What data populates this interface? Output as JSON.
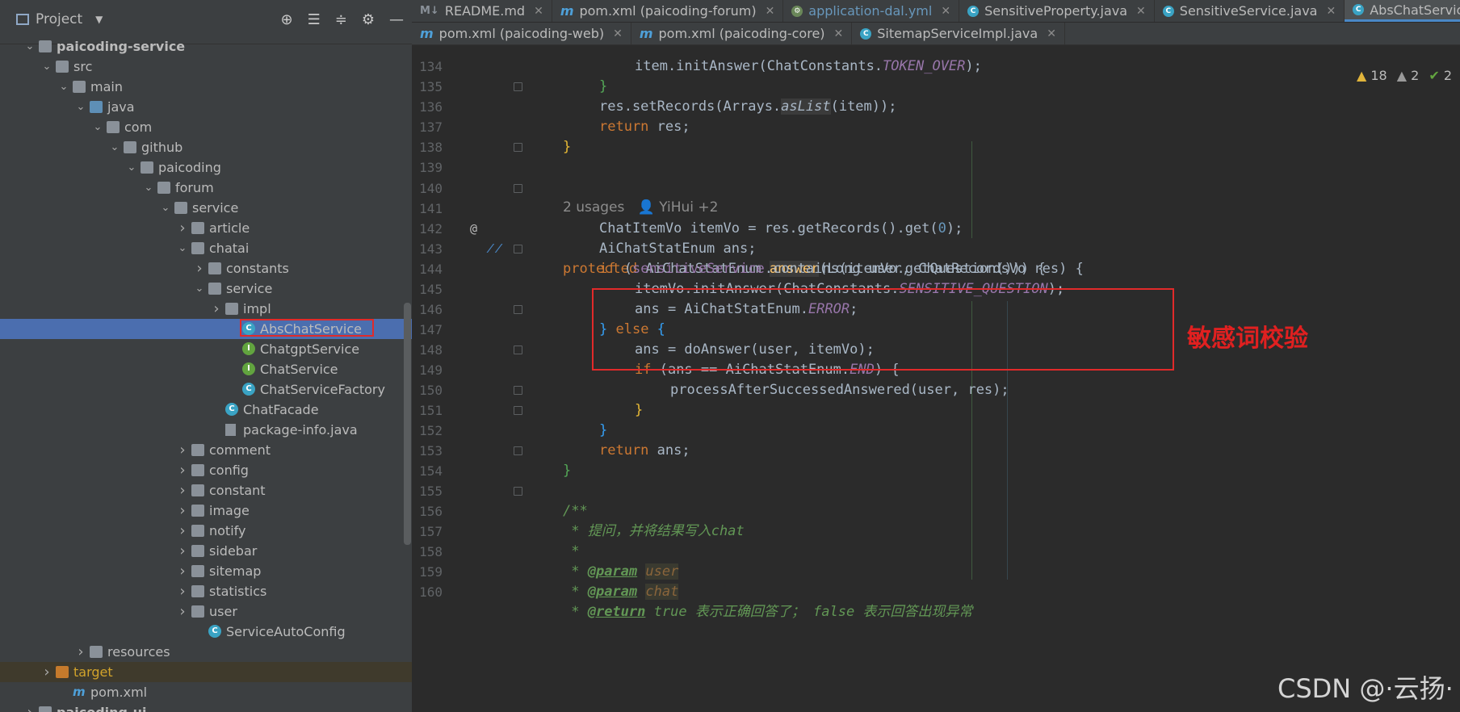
{
  "project_panel": {
    "title": "Project",
    "tree": [
      {
        "label": "paicoding-service",
        "depth": 0,
        "arrow": "down",
        "icon": "module-folder",
        "bold": true
      },
      {
        "label": "src",
        "depth": 1,
        "arrow": "down",
        "icon": "folder"
      },
      {
        "label": "main",
        "depth": 2,
        "arrow": "down",
        "icon": "folder"
      },
      {
        "label": "java",
        "depth": 3,
        "arrow": "down",
        "icon": "source-folder"
      },
      {
        "label": "com",
        "depth": 4,
        "arrow": "down",
        "icon": "package"
      },
      {
        "label": "github",
        "depth": 5,
        "arrow": "down",
        "icon": "package"
      },
      {
        "label": "paicoding",
        "depth": 6,
        "arrow": "down",
        "icon": "package"
      },
      {
        "label": "forum",
        "depth": 7,
        "arrow": "down",
        "icon": "package"
      },
      {
        "label": "service",
        "depth": 8,
        "arrow": "down",
        "icon": "package"
      },
      {
        "label": "article",
        "depth": 9,
        "arrow": "right",
        "icon": "package"
      },
      {
        "label": "chatai",
        "depth": 9,
        "arrow": "down",
        "icon": "package"
      },
      {
        "label": "constants",
        "depth": 10,
        "arrow": "right",
        "icon": "package"
      },
      {
        "label": "service",
        "depth": 10,
        "arrow": "down",
        "icon": "package"
      },
      {
        "label": "impl",
        "depth": 11,
        "arrow": "right",
        "icon": "package"
      },
      {
        "label": "AbsChatService",
        "depth": 12,
        "arrow": "",
        "icon": "class",
        "selected": true
      },
      {
        "label": "ChatgptService",
        "depth": 12,
        "arrow": "",
        "icon": "interface"
      },
      {
        "label": "ChatService",
        "depth": 12,
        "arrow": "",
        "icon": "interface"
      },
      {
        "label": "ChatServiceFactory",
        "depth": 12,
        "arrow": "",
        "icon": "class"
      },
      {
        "label": "ChatFacade",
        "depth": 11,
        "arrow": "",
        "icon": "class"
      },
      {
        "label": "package-info.java",
        "depth": 11,
        "arrow": "",
        "icon": "file"
      },
      {
        "label": "comment",
        "depth": 9,
        "arrow": "right",
        "icon": "package"
      },
      {
        "label": "config",
        "depth": 9,
        "arrow": "right",
        "icon": "package"
      },
      {
        "label": "constant",
        "depth": 9,
        "arrow": "right",
        "icon": "package"
      },
      {
        "label": "image",
        "depth": 9,
        "arrow": "right",
        "icon": "package"
      },
      {
        "label": "notify",
        "depth": 9,
        "arrow": "right",
        "icon": "package"
      },
      {
        "label": "sidebar",
        "depth": 9,
        "arrow": "right",
        "icon": "package"
      },
      {
        "label": "sitemap",
        "depth": 9,
        "arrow": "right",
        "icon": "package"
      },
      {
        "label": "statistics",
        "depth": 9,
        "arrow": "right",
        "icon": "package"
      },
      {
        "label": "user",
        "depth": 9,
        "arrow": "right",
        "icon": "package"
      },
      {
        "label": "ServiceAutoConfig",
        "depth": 10,
        "arrow": "",
        "icon": "class"
      },
      {
        "label": "resources",
        "depth": 3,
        "arrow": "right",
        "icon": "resources-folder"
      },
      {
        "label": "target",
        "depth": 1,
        "arrow": "right",
        "icon": "excluded-folder",
        "target": true
      },
      {
        "label": "pom.xml",
        "depth": 2,
        "arrow": "",
        "icon": "maven"
      },
      {
        "label": "paicoding-ui",
        "depth": 0,
        "arrow": "right",
        "icon": "module-folder",
        "bold": true
      }
    ]
  },
  "tabs_row1": [
    {
      "label": "README.md",
      "icon": "md"
    },
    {
      "label": "pom.xml (paicoding-forum)",
      "icon": "m"
    },
    {
      "label": "application-dal.yml",
      "icon": "yml"
    },
    {
      "label": "SensitiveProperty.java",
      "icon": "c"
    },
    {
      "label": "SensitiveService.java",
      "icon": "c"
    },
    {
      "label": "AbsChatService.java",
      "icon": "c",
      "active": true
    }
  ],
  "tabs_row2": [
    {
      "label": "pom.xml (paicoding-web)",
      "icon": "m"
    },
    {
      "label": "pom.xml (paicoding-core)",
      "icon": "m"
    },
    {
      "label": "SitemapServiceImpl.java",
      "icon": "c"
    }
  ],
  "inspections": {
    "warnings": "18",
    "weak_warnings": "2",
    "typos": "2"
  },
  "usage_hint": {
    "usages": "2 usages",
    "author": "YiHui +2"
  },
  "code_lines": [
    {
      "n": "134",
      "fold": false
    },
    {
      "n": "135",
      "fold": true
    },
    {
      "n": "136",
      "fold": false
    },
    {
      "n": "137",
      "fold": false
    },
    {
      "n": "138",
      "fold": true
    },
    {
      "n": "139",
      "fold": false
    },
    {
      "n": "140",
      "fold": true
    },
    {
      "n": "141",
      "fold": false
    },
    {
      "n": "142",
      "fold": false
    },
    {
      "n": "143",
      "fold": true
    },
    {
      "n": "144",
      "fold": false
    },
    {
      "n": "145",
      "fold": false
    },
    {
      "n": "146",
      "fold": true
    },
    {
      "n": "147",
      "fold": false
    },
    {
      "n": "148",
      "fold": true
    },
    {
      "n": "149",
      "fold": false
    },
    {
      "n": "150",
      "fold": true
    },
    {
      "n": "151",
      "fold": true
    },
    {
      "n": "152",
      "fold": false
    },
    {
      "n": "153",
      "fold": true
    },
    {
      "n": "154",
      "fold": false
    },
    {
      "n": "155",
      "fold": true
    },
    {
      "n": "156",
      "fold": false
    },
    {
      "n": "157",
      "fold": false
    },
    {
      "n": "158",
      "fold": false
    },
    {
      "n": "159",
      "fold": false
    },
    {
      "n": "160",
      "fold": false
    }
  ],
  "code": {
    "l134": {
      "a": "item.initAnswer(ChatConstants.",
      "b": "TOKEN_OVER",
      "c": ");"
    },
    "l135": "}",
    "l136": {
      "a": "res.setRecords(Arrays.",
      "b": "asList",
      "c": "(item));"
    },
    "l137": {
      "kw": "return",
      "rest": " res;"
    },
    "l138": "}",
    "l140": {
      "kw": "protected",
      "t1": " AiChatStatEnum ",
      "fn": "answer",
      "rest": "(Long user, ChatRecordsVo res) {"
    },
    "l141": {
      "a": "ChatItemVo itemVo = res.getRecords().get(",
      "num": "0",
      "c": ");"
    },
    "l142": "AiChatStatEnum ans;",
    "l143": {
      "kw": "if",
      "p1": " (",
      "fld": "sensitiveService",
      "rest": ".contains(itemVo.getQuestion())) {"
    },
    "l144": {
      "a": "itemVo.initAnswer(ChatConstants.",
      "b": "SENSITIVE_QUESTION",
      "c": ");"
    },
    "l145": {
      "a": "ans = AiChatStatEnum.",
      "b": "ERROR",
      "c": ";"
    },
    "l146": {
      "a": "} ",
      "kw": "else",
      "c": " {"
    },
    "l147": "ans = doAnswer(user, itemVo);",
    "l148": {
      "kw": "if",
      "a": " (ans == AiChatStatEnum.",
      "b": "END",
      "c": ") {"
    },
    "l149": "processAfterSuccessedAnswered(user, res);",
    "l150": "}",
    "l151": "}",
    "l152": {
      "kw": "return",
      "rest": " ans;"
    },
    "l153": "}",
    "l155": "/**",
    "l156": " * 提问，并将结果写入chat",
    "l157": " *",
    "l158": {
      "star": " * ",
      "tag": "@param",
      "p": "user"
    },
    "l159": {
      "star": " * ",
      "tag": "@param",
      "p": "chat"
    },
    "l160": {
      "star": " * ",
      "tag": "@return",
      "rest": " true 表示正确回答了； false 表示回答出现异常"
    }
  },
  "annotation_text": "敏感词校验",
  "watermark": "CSDN @·云扬·",
  "colors": {
    "highlight_box": "#e12a2a",
    "selection": "#4b6eaf",
    "editor_bg": "#2b2b2b",
    "panel_bg": "#3c3f41"
  }
}
